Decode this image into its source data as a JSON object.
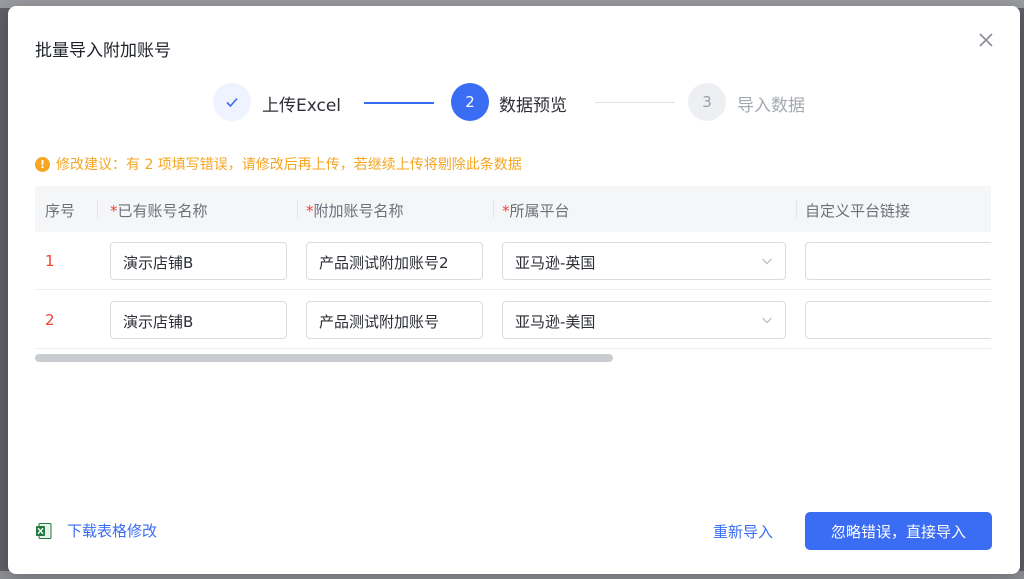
{
  "dialog": {
    "title": "批量导入附加账号"
  },
  "steps": [
    {
      "number": "",
      "label": "上传Excel",
      "state": "done"
    },
    {
      "number": "2",
      "label": "数据预览",
      "state": "active"
    },
    {
      "number": "3",
      "label": "导入数据",
      "state": "pending"
    }
  ],
  "warning": {
    "icon": "!",
    "text": "修改建议：有 2 项填写错误，请修改后再上传，若继续上传将剔除此条数据"
  },
  "table": {
    "columns": [
      {
        "label": "序号",
        "required": false
      },
      {
        "label": "已有账号名称",
        "required": true
      },
      {
        "label": "附加账号名称",
        "required": true
      },
      {
        "label": "所属平台",
        "required": true
      },
      {
        "label": "自定义平台链接",
        "required": false
      }
    ],
    "required_mark": "*",
    "rows": [
      {
        "index": "1",
        "account": "演示店铺B",
        "extra_account": "产品测试附加账号2",
        "platform": "亚马逊-英国",
        "link": ""
      },
      {
        "index": "2",
        "account": "演示店铺B",
        "extra_account": "产品测试附加账号",
        "platform": "亚马逊-美国",
        "link": ""
      }
    ]
  },
  "footer": {
    "download_label": "下载表格修改",
    "reimport_label": "重新导入",
    "primary_label": "忽略错误，直接导入"
  },
  "colors": {
    "primary": "#3a6cf4",
    "warning": "#f5a623",
    "error": "#f04134"
  }
}
